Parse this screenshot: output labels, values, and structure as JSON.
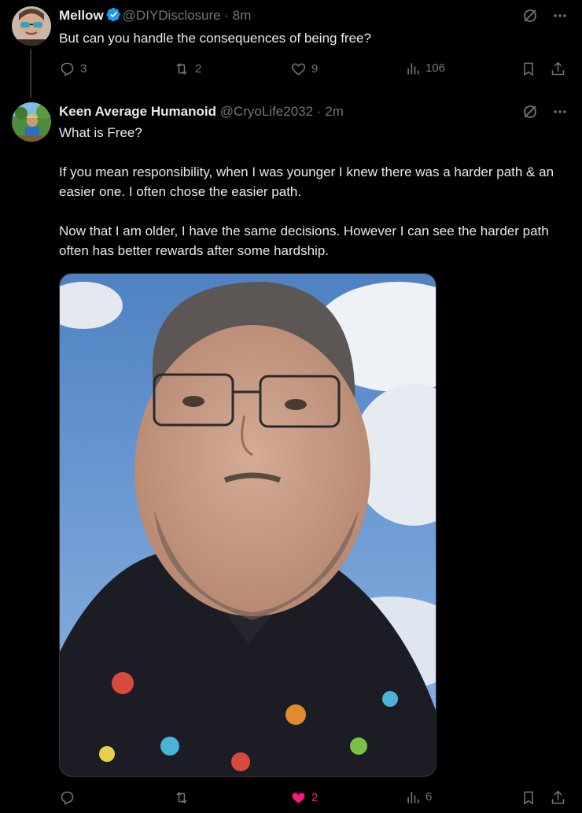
{
  "tweets": [
    {
      "display_name": "Mellow",
      "handle": "@DIYDisclosure",
      "separator": "·",
      "time": "8m",
      "text": [
        "But can you handle the consequences of being free?"
      ],
      "actions": {
        "replies": "3",
        "reposts": "2",
        "likes": "9",
        "views": "106"
      }
    },
    {
      "display_name": "Keen Average Humanoid",
      "handle": "@CryoLife2032",
      "separator": "·",
      "time": "2m",
      "text": [
        "What is Free?",
        "If you mean responsibility, when I was younger I knew there was a harder path & an easier one. I often chose the easier path.",
        "Now that I am older, I have the same decisions. However I can see the harder path often has better rewards after some hardship."
      ],
      "actions": {
        "replies": "",
        "reposts": "",
        "likes": "2",
        "views": "6"
      }
    }
  ],
  "colors": {
    "background": "#000000",
    "text": "#e7e9ea",
    "muted": "#71767b",
    "verified": "#1d9bf0",
    "like_active": "#f91880"
  },
  "icons": [
    "verified-badge-icon",
    "grok-icon",
    "more-icon",
    "reply-icon",
    "repost-icon",
    "like-icon",
    "views-icon",
    "bookmark-icon",
    "share-icon"
  ]
}
